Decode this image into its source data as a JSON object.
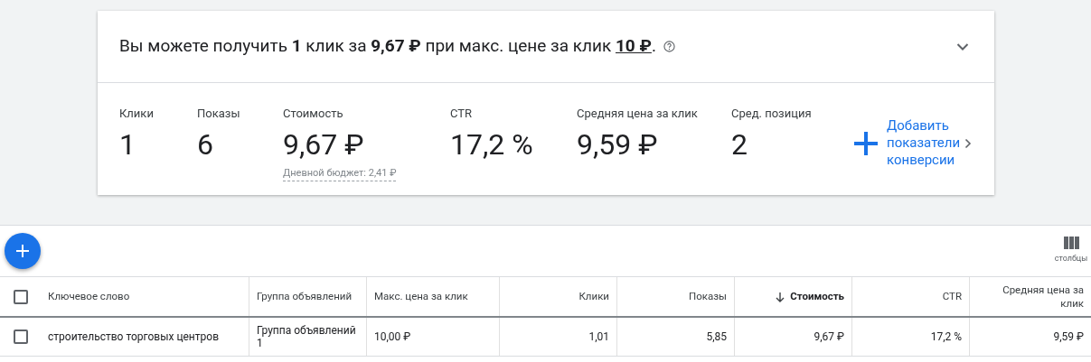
{
  "summary": {
    "text": "Вы можете получить **1** клик за **9,67 ₽** при макс. цене за клик ",
    "bid_link": "10 ₽",
    "after": ".",
    "expanded": false
  },
  "metrics": [
    {
      "label": "Клики",
      "value": "1"
    },
    {
      "label": "Показы",
      "value": "6"
    },
    {
      "label": "Стоимость",
      "value": "9,67 ₽",
      "note": "Дневной бюджет: 2,41 ₽"
    },
    {
      "label": "CTR",
      "value": "17,2 %"
    },
    {
      "label": "Средняя цена за клик",
      "value": "9,59 ₽"
    },
    {
      "label": "Сред. позиция",
      "value": "2"
    }
  ],
  "add_metrics": {
    "lines": [
      "Добавить",
      "показатели",
      "конверсии"
    ]
  },
  "toolbar": {
    "columns_label": "столбцы"
  },
  "table": {
    "select_all_checked": false,
    "columns": [
      {
        "label": "Ключевое слово",
        "sorted": false
      },
      {
        "label": "Группа объявлений",
        "sorted": false
      },
      {
        "label": "Макс. цена за клик",
        "sorted": false
      },
      {
        "label": "Клики",
        "sorted": false
      },
      {
        "label": "Показы",
        "sorted": false
      },
      {
        "label": "Стоимость",
        "sorted": true
      },
      {
        "label": "CTR",
        "sorted": false
      },
      {
        "label": "Средняя цена за клик",
        "sorted": false
      }
    ],
    "rows": [
      {
        "checked": false,
        "cells": [
          "строительство торговых центров",
          "Группа объявлений 1",
          "10,00 ₽",
          "1,01",
          "5,85",
          "9,67 ₽",
          "17,2 %",
          "9,59 ₽"
        ]
      }
    ]
  }
}
